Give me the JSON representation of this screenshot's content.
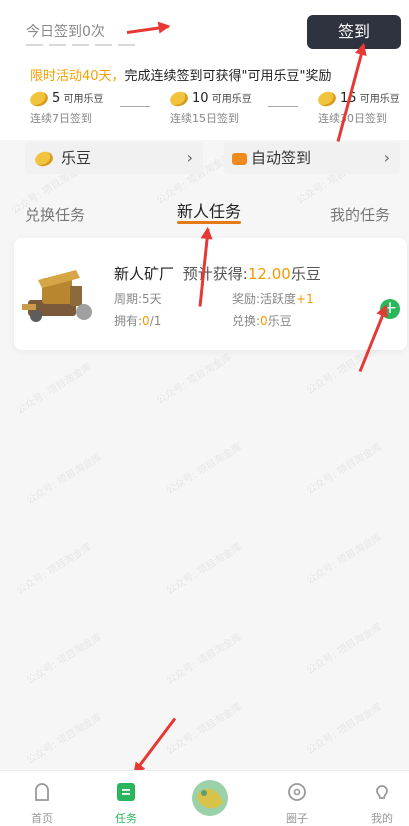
{
  "header": {
    "today_signin": "今日签到0次",
    "signin_button": "签到",
    "promo_highlight": "限时活动40天，",
    "promo_text": "完成连续签到可获得\"可用乐豆\"奖励"
  },
  "rewards": [
    {
      "amount": "5",
      "unit": "可用乐豆",
      "caption": "连续7日签到"
    },
    {
      "amount": "10",
      "unit": "可用乐豆",
      "caption": "连续15日签到"
    },
    {
      "amount": "15",
      "unit": "可用乐豆",
      "caption": "连续30日签到"
    }
  ],
  "quick": {
    "ledou": "乐豆",
    "auto_signin": "自动签到"
  },
  "tabs": {
    "exchange": "兑换任务",
    "newbie": "新人任务",
    "mine": "我的任务"
  },
  "task": {
    "name": "新人矿厂",
    "expected_label": "预计获得:",
    "expected_value": "12.00",
    "expected_unit": "乐豆",
    "period_label": "周期:",
    "period_value": "5天",
    "reward_label": "奖励:活跃度",
    "reward_value": "+1",
    "own_label": "拥有:",
    "own_value": "0",
    "own_total": "/1",
    "exchange_label": "兑换:",
    "exchange_value": "0",
    "exchange_unit": "乐豆"
  },
  "watermark": "公众号: 项目淘金库",
  "nav": [
    {
      "label": "首页"
    },
    {
      "label": "任务"
    },
    {
      "label": ""
    },
    {
      "label": "圈子"
    },
    {
      "label": "我的"
    }
  ],
  "colors": {
    "accent_orange": "#f59a00",
    "accent_green": "#2ab65a",
    "button_dark": "#2f3340",
    "annotation_red": "#e53935"
  }
}
